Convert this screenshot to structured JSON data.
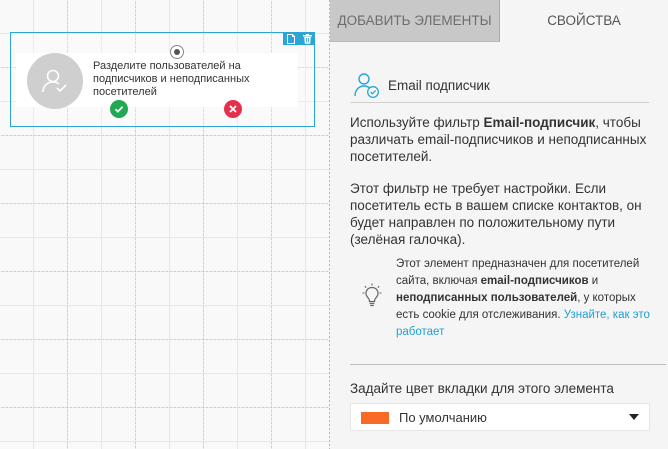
{
  "canvas": {
    "node": {
      "text": "Разделите пользователей на подписчиков и неподписанных посетителей",
      "toolbar_icons": [
        "copy-icon",
        "trash-icon"
      ],
      "yes_icon": "check-icon",
      "no_icon": "close-icon"
    }
  },
  "tabs": {
    "add_elements": "ДОБАВИТЬ ЭЛЕМЕНТЫ",
    "properties": "СВОЙСТВА"
  },
  "properties": {
    "icon": "user-check-icon",
    "title": "Email подписчик",
    "desc1_pre": "Используйте фильтр ",
    "desc1_bold": "Email-подписчик",
    "desc1_post": ", чтобы различать email-подписчиков и неподписанных посетителей.",
    "desc2": "Этот фильтр не требует настройки. Если посетитель есть в вашем списке контактов, он будет направлен по положительному пути (зелёная галочка).",
    "tip": {
      "icon": "lightbulb-icon",
      "part1": "Этот элемент предназначен для посетителей сайта, включая ",
      "bold1": "email-подписчиков",
      "part2": " и ",
      "bold2": "неподписанных пользователей",
      "part3": ", у которых есть cookie для отслеживания. ",
      "link": "Узнайте, как это работает"
    },
    "color_label": "Задайте цвет вкладки для этого элемента",
    "color_select": {
      "value": "По умолчанию",
      "swatch": "#f96a26"
    }
  },
  "colors": {
    "selection": "#2aa5d6",
    "yes": "#21a853",
    "no": "#e5304b",
    "link": "#1fa0d5"
  }
}
